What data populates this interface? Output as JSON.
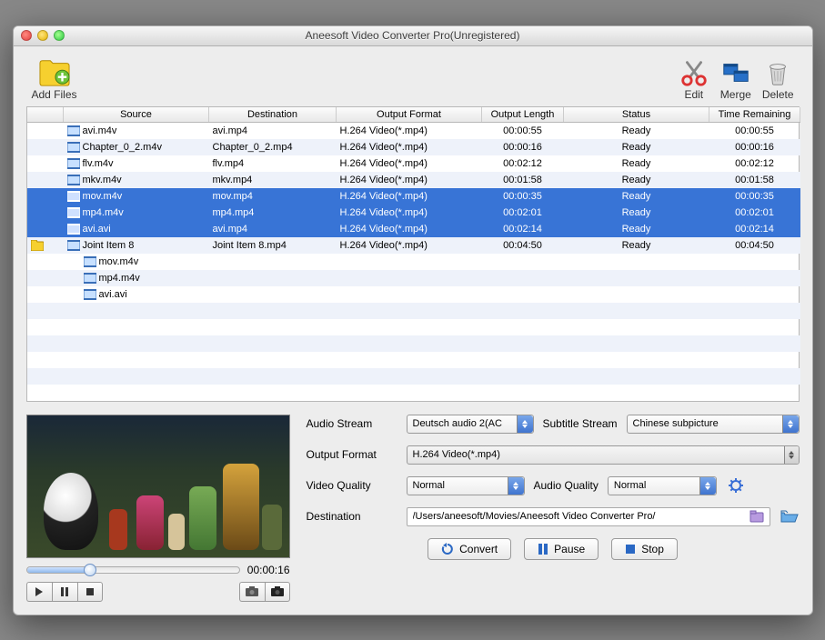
{
  "window": {
    "title": "Aneesoft Video Converter Pro(Unregistered)"
  },
  "toolbar": {
    "add_files": "Add Files",
    "edit": "Edit",
    "merge": "Merge",
    "delete": "Delete"
  },
  "columns": {
    "col0": "",
    "source": "Source",
    "destination": "Destination",
    "output_format": "Output Format",
    "output_length": "Output Length",
    "status": "Status",
    "time_remaining": "Time Remaining"
  },
  "rows": [
    {
      "indent": 0,
      "folder": false,
      "source": "avi.m4v",
      "dest": "avi.mp4",
      "fmt": "H.264 Video(*.mp4)",
      "len": "00:00:55",
      "status": "Ready",
      "rem": "00:00:55",
      "selected": false
    },
    {
      "indent": 0,
      "folder": false,
      "source": "Chapter_0_2.m4v",
      "dest": "Chapter_0_2.mp4",
      "fmt": "H.264 Video(*.mp4)",
      "len": "00:00:16",
      "status": "Ready",
      "rem": "00:00:16",
      "selected": false
    },
    {
      "indent": 0,
      "folder": false,
      "source": "flv.m4v",
      "dest": "flv.mp4",
      "fmt": "H.264 Video(*.mp4)",
      "len": "00:02:12",
      "status": "Ready",
      "rem": "00:02:12",
      "selected": false
    },
    {
      "indent": 0,
      "folder": false,
      "source": "mkv.m4v",
      "dest": "mkv.mp4",
      "fmt": "H.264 Video(*.mp4)",
      "len": "00:01:58",
      "status": "Ready",
      "rem": "00:01:58",
      "selected": false
    },
    {
      "indent": 0,
      "folder": false,
      "source": "mov.m4v",
      "dest": "mov.mp4",
      "fmt": "H.264 Video(*.mp4)",
      "len": "00:00:35",
      "status": "Ready",
      "rem": "00:00:35",
      "selected": true
    },
    {
      "indent": 0,
      "folder": false,
      "source": "mp4.m4v",
      "dest": "mp4.mp4",
      "fmt": "H.264 Video(*.mp4)",
      "len": "00:02:01",
      "status": "Ready",
      "rem": "00:02:01",
      "selected": true
    },
    {
      "indent": 0,
      "folder": false,
      "source": "avi.avi",
      "dest": "avi.mp4",
      "fmt": "H.264 Video(*.mp4)",
      "len": "00:02:14",
      "status": "Ready",
      "rem": "00:02:14",
      "selected": true
    },
    {
      "indent": 0,
      "folder": true,
      "source": "Joint Item 8",
      "dest": "Joint Item 8.mp4",
      "fmt": "H.264 Video(*.mp4)",
      "len": "00:04:50",
      "status": "Ready",
      "rem": "00:04:50",
      "selected": false
    },
    {
      "indent": 1,
      "folder": false,
      "source": "mov.m4v",
      "dest": "",
      "fmt": "",
      "len": "",
      "status": "",
      "rem": "",
      "selected": false
    },
    {
      "indent": 1,
      "folder": false,
      "source": "mp4.m4v",
      "dest": "",
      "fmt": "",
      "len": "",
      "status": "",
      "rem": "",
      "selected": false
    },
    {
      "indent": 1,
      "folder": false,
      "source": "avi.avi",
      "dest": "",
      "fmt": "",
      "len": "",
      "status": "",
      "rem": "",
      "selected": false
    }
  ],
  "blank_rows": 6,
  "preview": {
    "time": "00:00:16"
  },
  "settings": {
    "audio_stream_label": "Audio Stream",
    "audio_stream_value": "Deutsch audio 2(AC",
    "subtitle_stream_label": "Subtitle Stream",
    "subtitle_stream_value": "Chinese subpicture",
    "output_format_label": "Output Format",
    "output_format_value": "H.264 Video(*.mp4)",
    "video_quality_label": "Video Quality",
    "video_quality_value": "Normal",
    "audio_quality_label": "Audio Quality",
    "audio_quality_value": "Normal",
    "destination_label": "Destination",
    "destination_value": "/Users/aneesoft/Movies/Aneesoft Video Converter Pro/"
  },
  "actions": {
    "convert": "Convert",
    "pause": "Pause",
    "stop": "Stop"
  }
}
